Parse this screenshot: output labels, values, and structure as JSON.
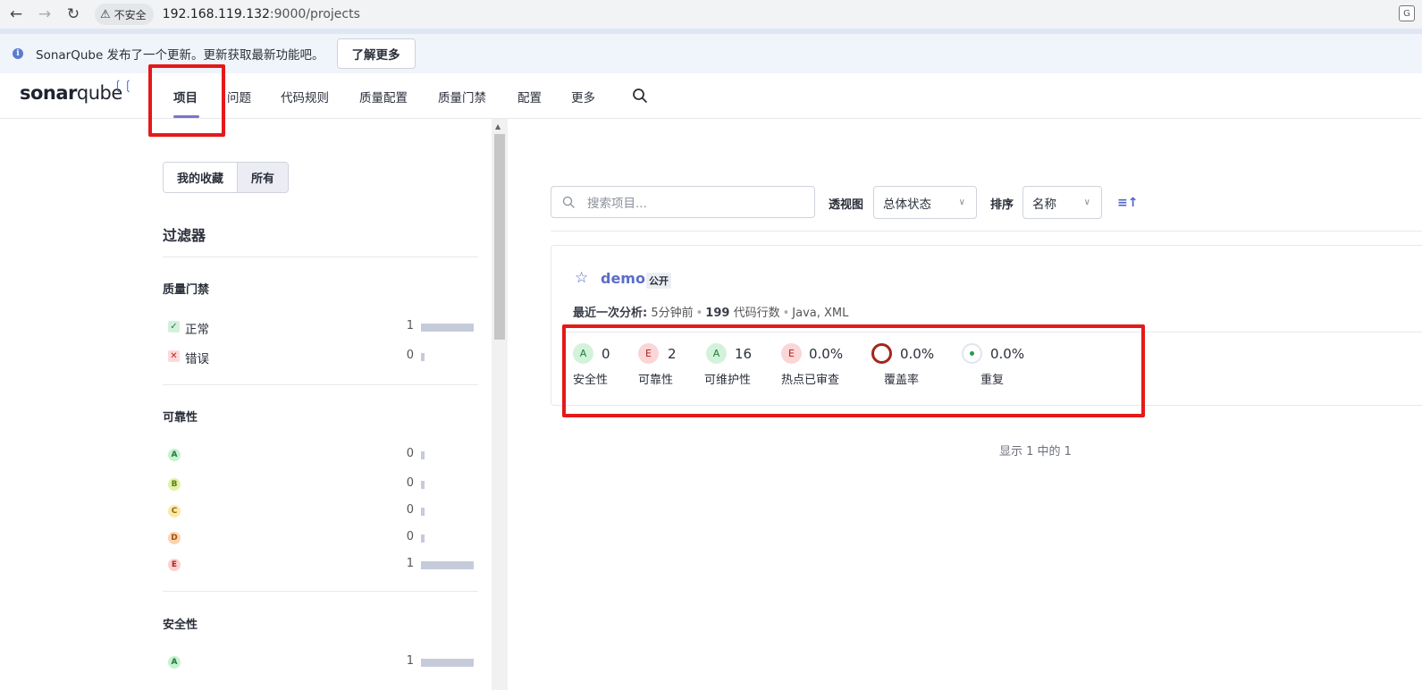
{
  "browser": {
    "insecure_label": "不安全",
    "url_host": "192.168.119.132",
    "url_rest": ":9000/projects"
  },
  "banner": {
    "message": "SonarQube 发布了一个更新。更新获取最新功能吧。",
    "learn_more": "了解更多"
  },
  "logo": {
    "part1": "sonar",
    "part2": "qube"
  },
  "nav": {
    "items": [
      "项目",
      "问题",
      "代码规则",
      "质量配置",
      "质量门禁",
      "配置",
      "更多"
    ],
    "active": "项目"
  },
  "sidebar": {
    "segment": {
      "favorites": "我的收藏",
      "all": "所有"
    },
    "filters_title": "过滤器",
    "quality_gate": {
      "title": "质量门禁",
      "rows": [
        {
          "label": "正常",
          "count": "1",
          "fraction": 1.0
        },
        {
          "label": "错误",
          "count": "0",
          "fraction": 0.0
        }
      ]
    },
    "reliability": {
      "title": "可靠性",
      "rows": [
        {
          "grade": "A",
          "count": "0",
          "fraction": 0.0
        },
        {
          "grade": "B",
          "count": "0",
          "fraction": 0.0
        },
        {
          "grade": "C",
          "count": "0",
          "fraction": 0.0
        },
        {
          "grade": "D",
          "count": "0",
          "fraction": 0.0
        },
        {
          "grade": "E",
          "count": "1",
          "fraction": 1.0
        }
      ]
    },
    "security": {
      "title": "安全性",
      "rows": [
        {
          "grade": "A",
          "count": "1",
          "fraction": 1.0
        }
      ]
    }
  },
  "toolbar": {
    "search_placeholder": "搜索项目...",
    "perspective_label": "透视图",
    "perspective_value": "总体状态",
    "sort_label": "排序",
    "sort_value": "名称"
  },
  "project": {
    "name": "demo",
    "visibility": "公开",
    "last_analysis_label": "最近一次分析:",
    "last_analysis_value": "5分钟前",
    "loc_value": "199",
    "loc_label": "代码行数",
    "languages": "Java, XML",
    "metrics": {
      "security": {
        "grade": "A",
        "value": "0",
        "label": "安全性"
      },
      "reliability": {
        "grade": "E",
        "value": "2",
        "label": "可靠性"
      },
      "maintainability": {
        "grade": "A",
        "value": "16",
        "label": "可维护性"
      },
      "hotspots": {
        "grade": "E",
        "value": "0.0%",
        "label": "热点已审查"
      },
      "coverage": {
        "value": "0.0%",
        "label": "覆盖率"
      },
      "duplications": {
        "value": "0.0%",
        "label": "重复"
      }
    }
  },
  "pagination": "显示 1 中的 1",
  "colors": {
    "accent": "#7b74c9",
    "link": "#5b6dc9",
    "highlight": "#e51919"
  }
}
